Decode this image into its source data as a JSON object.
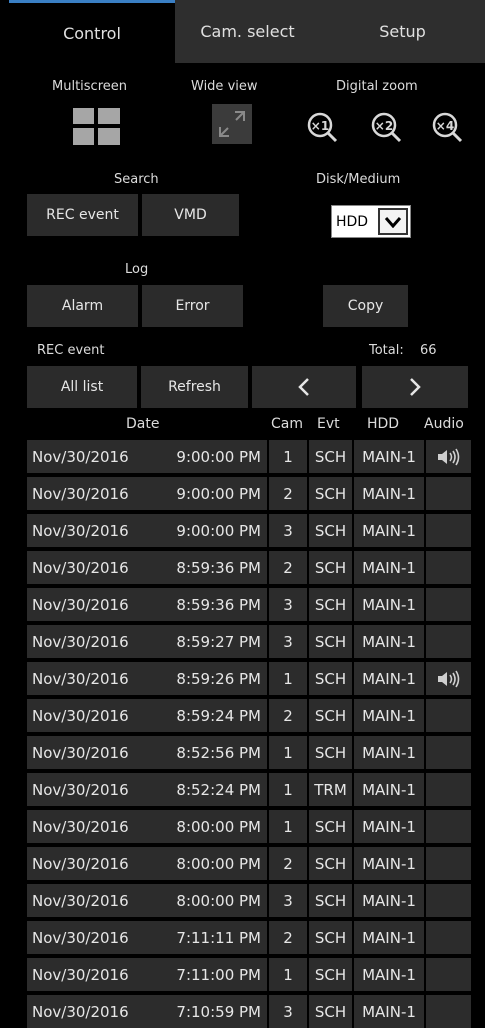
{
  "tabs": [
    {
      "label": "Control",
      "active": true
    },
    {
      "label": "Cam. select",
      "active": false
    },
    {
      "label": "Setup",
      "active": false
    }
  ],
  "control": {
    "multiscreen_label": "Multiscreen",
    "wide_view_label": "Wide view",
    "digital_zoom_label": "Digital zoom",
    "zoom_levels": [
      "×1",
      "×2",
      "×4"
    ],
    "search_label": "Search",
    "rec_event_button": "REC event",
    "vmd_button": "VMD",
    "disk_medium_label": "Disk/Medium",
    "disk_value": "HDD",
    "log_label": "Log",
    "alarm_button": "Alarm",
    "error_button": "Error",
    "copy_button": "Copy",
    "rec_event_label": "REC event",
    "total_label": "Total:",
    "total_value": "66",
    "all_list_button": "All list",
    "refresh_button": "Refresh"
  },
  "columns": [
    "Date",
    "Cam",
    "Evt",
    "HDD",
    "Audio"
  ],
  "rows": [
    {
      "date": "Nov/30/2016",
      "time": "9:00:00 PM",
      "cam": "1",
      "evt": "SCH",
      "hdd": "MAIN-1",
      "audio": true
    },
    {
      "date": "Nov/30/2016",
      "time": "9:00:00 PM",
      "cam": "2",
      "evt": "SCH",
      "hdd": "MAIN-1",
      "audio": false
    },
    {
      "date": "Nov/30/2016",
      "time": "9:00:00 PM",
      "cam": "3",
      "evt": "SCH",
      "hdd": "MAIN-1",
      "audio": false
    },
    {
      "date": "Nov/30/2016",
      "time": "8:59:36 PM",
      "cam": "2",
      "evt": "SCH",
      "hdd": "MAIN-1",
      "audio": false
    },
    {
      "date": "Nov/30/2016",
      "time": "8:59:36 PM",
      "cam": "3",
      "evt": "SCH",
      "hdd": "MAIN-1",
      "audio": false
    },
    {
      "date": "Nov/30/2016",
      "time": "8:59:27 PM",
      "cam": "3",
      "evt": "SCH",
      "hdd": "MAIN-1",
      "audio": false
    },
    {
      "date": "Nov/30/2016",
      "time": "8:59:26 PM",
      "cam": "1",
      "evt": "SCH",
      "hdd": "MAIN-1",
      "audio": true
    },
    {
      "date": "Nov/30/2016",
      "time": "8:59:24 PM",
      "cam": "2",
      "evt": "SCH",
      "hdd": "MAIN-1",
      "audio": false
    },
    {
      "date": "Nov/30/2016",
      "time": "8:52:56 PM",
      "cam": "1",
      "evt": "SCH",
      "hdd": "MAIN-1",
      "audio": false
    },
    {
      "date": "Nov/30/2016",
      "time": "8:52:24 PM",
      "cam": "1",
      "evt": "TRM",
      "hdd": "MAIN-1",
      "audio": false
    },
    {
      "date": "Nov/30/2016",
      "time": "8:00:00 PM",
      "cam": "1",
      "evt": "SCH",
      "hdd": "MAIN-1",
      "audio": false
    },
    {
      "date": "Nov/30/2016",
      "time": "8:00:00 PM",
      "cam": "2",
      "evt": "SCH",
      "hdd": "MAIN-1",
      "audio": false
    },
    {
      "date": "Nov/30/2016",
      "time": "8:00:00 PM",
      "cam": "3",
      "evt": "SCH",
      "hdd": "MAIN-1",
      "audio": false
    },
    {
      "date": "Nov/30/2016",
      "time": "7:11:11 PM",
      "cam": "2",
      "evt": "SCH",
      "hdd": "MAIN-1",
      "audio": false
    },
    {
      "date": "Nov/30/2016",
      "time": "7:11:00 PM",
      "cam": "1",
      "evt": "SCH",
      "hdd": "MAIN-1",
      "audio": false
    },
    {
      "date": "Nov/30/2016",
      "time": "7:10:59 PM",
      "cam": "3",
      "evt": "SCH",
      "hdd": "MAIN-1",
      "audio": false
    }
  ]
}
